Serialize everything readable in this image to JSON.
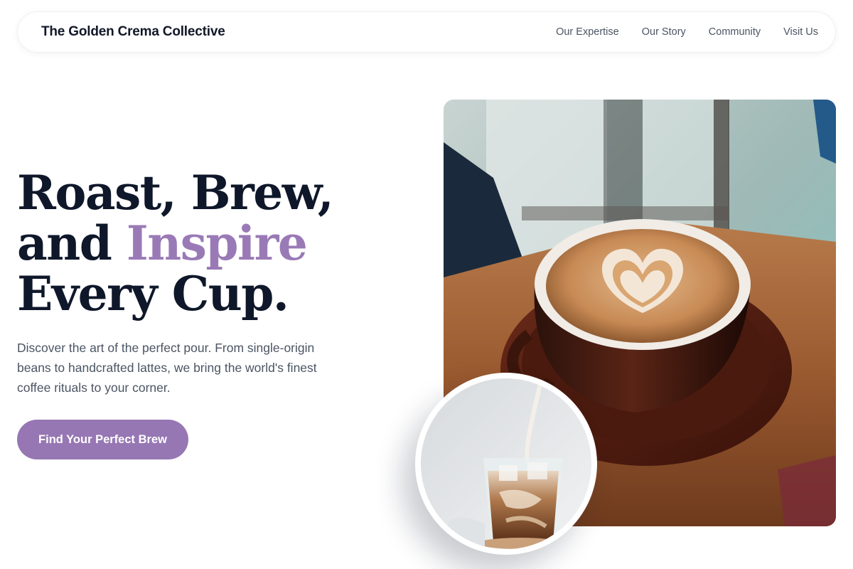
{
  "brand": {
    "name": "The Golden Crema Collective"
  },
  "nav": {
    "links": [
      "Our Expertise",
      "Our Story",
      "Community",
      "Visit Us"
    ]
  },
  "hero": {
    "title_line1": "Roast, Brew,",
    "title_line2_prefix": "and ",
    "title_line2_accent": "Inspire",
    "title_line3": "Every Cup.",
    "description": "Discover the art of the perfect pour. From single-origin beans to handcrafted lattes, we bring the world's finest coffee rituals to your corner.",
    "cta_label": "Find Your Perfect Brew"
  },
  "images": {
    "main": "latte-art-cup-photo",
    "secondary": "iced-latte-pour-photo"
  },
  "colors": {
    "accent": "#9a7ab6",
    "button": "#9677b3",
    "heading": "#0f172a",
    "body_text": "#4b5563"
  }
}
